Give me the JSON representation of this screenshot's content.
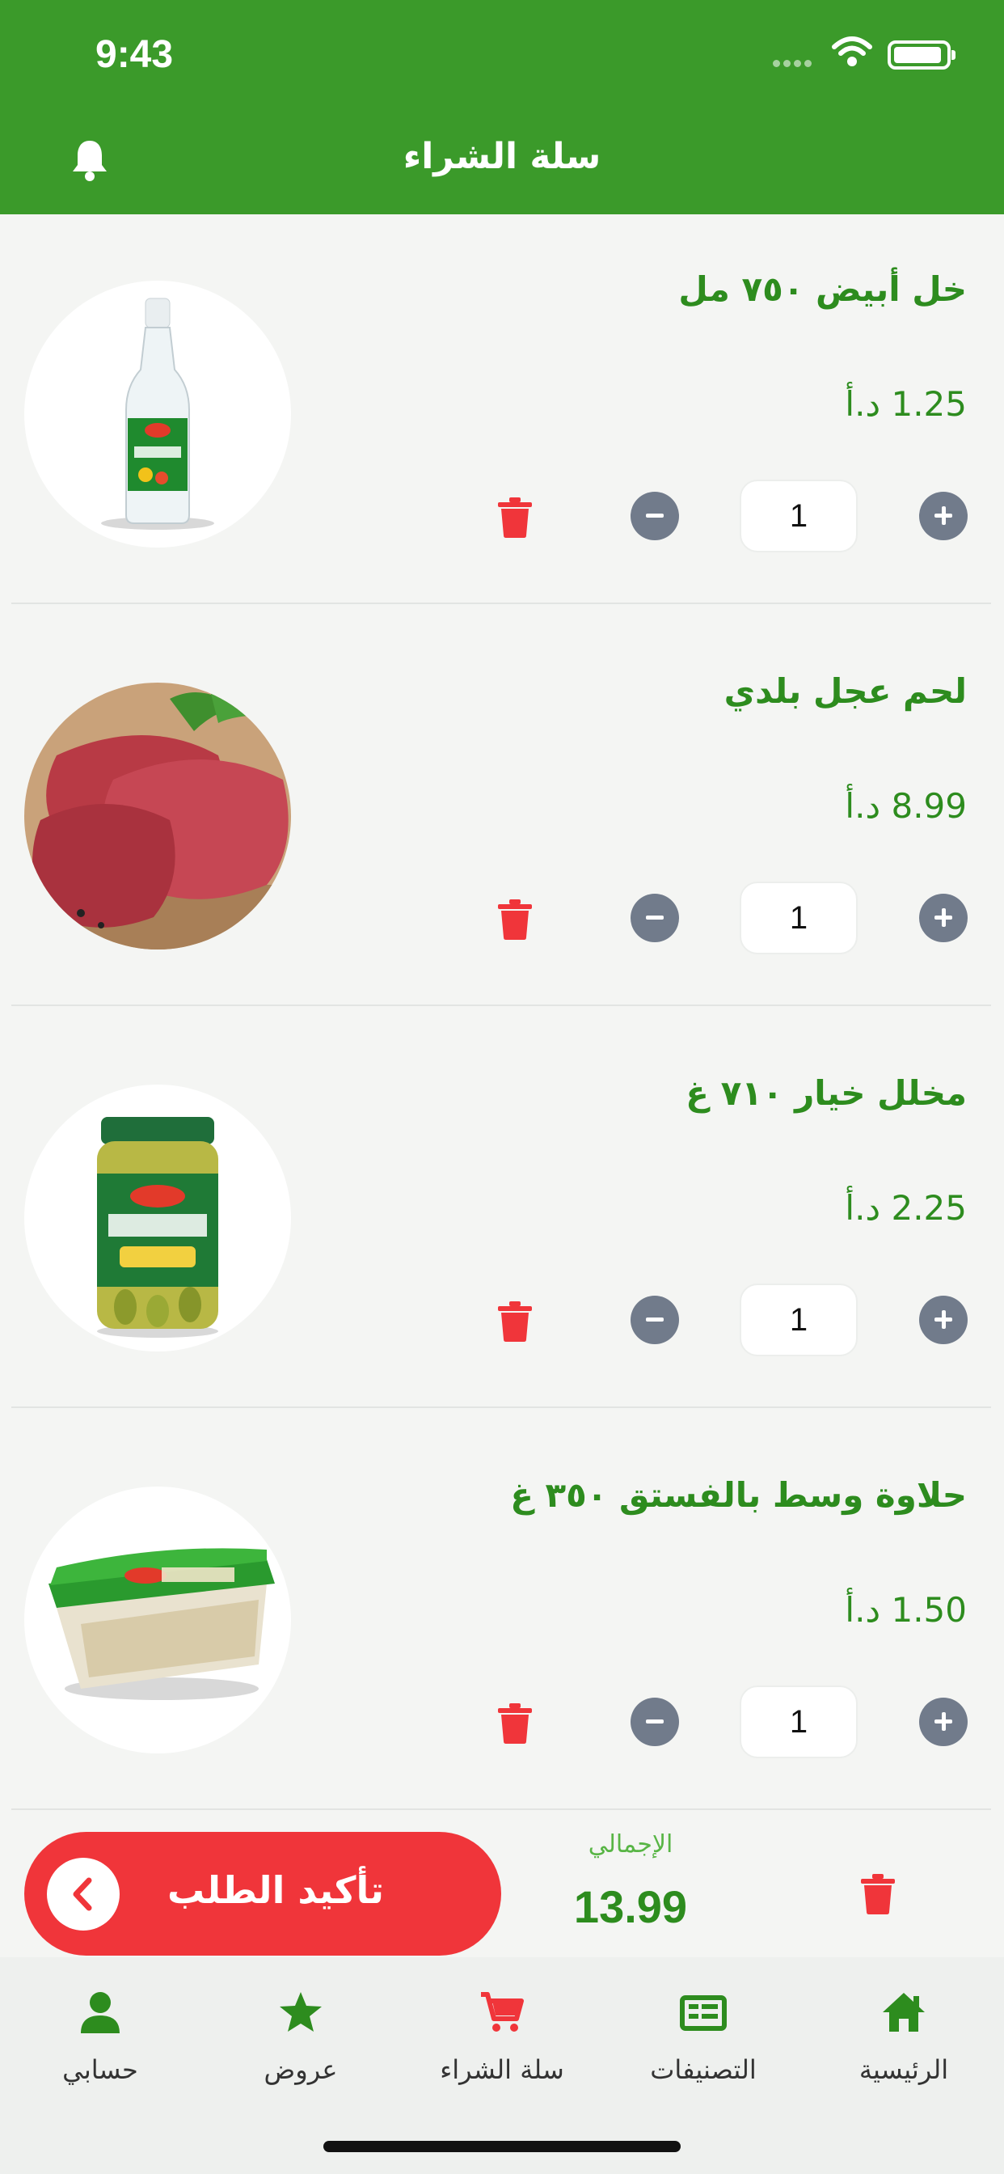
{
  "status_bar": {
    "time": "9:43"
  },
  "header": {
    "title": "سلة الشراء"
  },
  "cart": {
    "items": [
      {
        "name": "خل أبيض ٧٥٠ مل",
        "price": "1.25 د.أ",
        "quantity": "1",
        "image": "white-vinegar-bottle"
      },
      {
        "name": "لحم عجل بلدي",
        "price": "8.99 د.أ",
        "quantity": "1",
        "image": "veal-steaks"
      },
      {
        "name": "مخلل خيار ٧١٠ غ",
        "price": "2.25 د.أ",
        "quantity": "1",
        "image": "pickled-cucumber-jar"
      },
      {
        "name": "حلاوة وسط بالفستق ٣٥٠ غ",
        "price": "1.50 د.أ",
        "quantity": "1",
        "image": "halawa-tub"
      }
    ]
  },
  "checkout": {
    "confirm_label": "تأكيد الطلب",
    "total_caption": "الإجمالي",
    "total_value": "13.99"
  },
  "tabs": [
    {
      "label": "الرئيسية",
      "icon": "home-icon"
    },
    {
      "label": "التصنيفات",
      "icon": "categories-icon"
    },
    {
      "label": "سلة الشراء",
      "icon": "cart-icon"
    },
    {
      "label": "عروض",
      "icon": "star-icon"
    },
    {
      "label": "حسابي",
      "icon": "user-icon"
    }
  ],
  "colors": {
    "brand_green": "#3b9a2a",
    "text_green": "#2d8c1e",
    "danger_red": "#f0353a",
    "stepper_gray": "#717b8b"
  }
}
